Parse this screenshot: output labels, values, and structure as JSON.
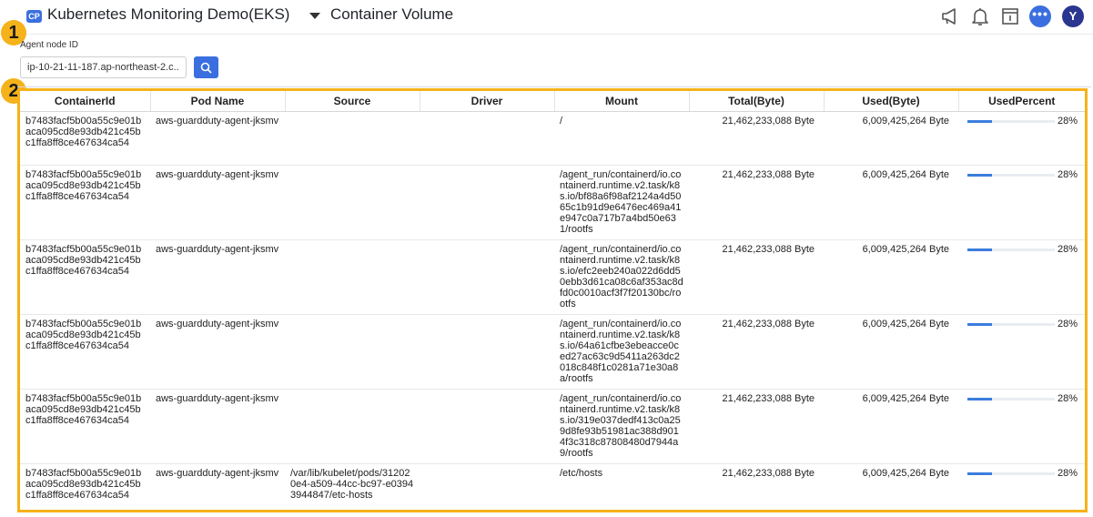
{
  "header": {
    "badge": "CP",
    "project_title": "Kubernetes Monitoring Demo(EKS)",
    "page_title": "Container Volume",
    "icons": [
      "megaphone-icon",
      "bell-icon",
      "document-icon",
      "chat-icon",
      "user-avatar"
    ],
    "avatar_letter": "Y",
    "dots": "•••"
  },
  "steps": [
    "1",
    "2"
  ],
  "filter": {
    "label": "Agent node ID",
    "value": "ip-10-21-11-187.ap-northeast-2.c..."
  },
  "table": {
    "columns": [
      "ContainerId",
      "Pod Name",
      "Source",
      "Driver",
      "Mount",
      "Total(Byte)",
      "Used(Byte)",
      "UsedPercent"
    ],
    "rows": [
      {
        "container_id": "b7483facf5b00a55c9e01baca095cd8e93db421c45bc1ffa8ff8ce467634ca54",
        "pod_name": "aws-guardduty-agent-jksmv",
        "source": "",
        "driver": "",
        "mount": "/",
        "total": "21,462,233,088 Byte",
        "used": "6,009,425,264 Byte",
        "used_percent": 28,
        "used_percent_label": "28%"
      },
      {
        "container_id": "b7483facf5b00a55c9e01baca095cd8e93db421c45bc1ffa8ff8ce467634ca54",
        "pod_name": "aws-guardduty-agent-jksmv",
        "source": "",
        "driver": "",
        "mount": "/agent_run/containerd/io.containerd.runtime.v2.task/k8s.io/bf88a6f98af2124a4d5065c1b91d9e6476ec469a41e947c0a717b7a4bd50e631/rootfs",
        "total": "21,462,233,088 Byte",
        "used": "6,009,425,264 Byte",
        "used_percent": 28,
        "used_percent_label": "28%"
      },
      {
        "container_id": "b7483facf5b00a55c9e01baca095cd8e93db421c45bc1ffa8ff8ce467634ca54",
        "pod_name": "aws-guardduty-agent-jksmv",
        "source": "",
        "driver": "",
        "mount": "/agent_run/containerd/io.containerd.runtime.v2.task/k8s.io/efc2eeb240a022d6dd50ebb3d61ca08c6af353ac8dfd0c0010acf3f7f20130bc/rootfs",
        "total": "21,462,233,088 Byte",
        "used": "6,009,425,264 Byte",
        "used_percent": 28,
        "used_percent_label": "28%"
      },
      {
        "container_id": "b7483facf5b00a55c9e01baca095cd8e93db421c45bc1ffa8ff8ce467634ca54",
        "pod_name": "aws-guardduty-agent-jksmv",
        "source": "",
        "driver": "",
        "mount": "/agent_run/containerd/io.containerd.runtime.v2.task/k8s.io/64a61cfbe3ebeacce0ced27ac63c9d5411a263dc2018c848f1c0281a71e30a8a/rootfs",
        "total": "21,462,233,088 Byte",
        "used": "6,009,425,264 Byte",
        "used_percent": 28,
        "used_percent_label": "28%"
      },
      {
        "container_id": "b7483facf5b00a55c9e01baca095cd8e93db421c45bc1ffa8ff8ce467634ca54",
        "pod_name": "aws-guardduty-agent-jksmv",
        "source": "",
        "driver": "",
        "mount": "/agent_run/containerd/io.containerd.runtime.v2.task/k8s.io/319e037dedf413c0a259d8fe93b51981ac388d9014f3c318c87808480d7944a9/rootfs",
        "total": "21,462,233,088 Byte",
        "used": "6,009,425,264 Byte",
        "used_percent": 28,
        "used_percent_label": "28%"
      },
      {
        "container_id": "b7483facf5b00a55c9e01baca095cd8e93db421c45bc1ffa8ff8ce467634ca54",
        "pod_name": "aws-guardduty-agent-jksmv",
        "source": "/var/lib/kubelet/pods/312020e4-a509-44cc-bc97-e03943944847/etc-hosts",
        "driver": "",
        "mount": "/etc/hosts",
        "total": "21,462,233,088 Byte",
        "used": "6,009,425,264 Byte",
        "used_percent": 28,
        "used_percent_label": "28%"
      }
    ]
  },
  "colors": {
    "accent": "#3b6fe0",
    "highlight": "#f5b21a",
    "bar_fill": "#3b7ddd",
    "avatar": "#2a3690"
  }
}
